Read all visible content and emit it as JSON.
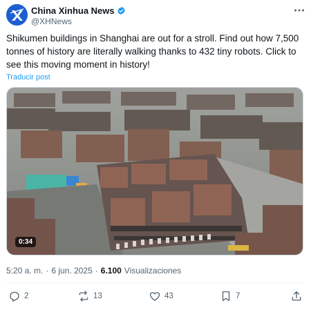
{
  "account": {
    "display_name": "China Xinhua News",
    "handle": "@XHNews",
    "avatar_logo_text": "NEW CHINA",
    "verified_icon": "verified-badge-icon"
  },
  "post": {
    "text": "Shikumen buildings in Shanghai are out for a stroll. Find out how 7,500 tonnes of history are literally walking thanks to 432 tiny robots. Click to see this moving moment in history!",
    "translate_label": "Traducir post"
  },
  "media": {
    "type": "video",
    "duration": "0:34",
    "description_icon": "video-thumbnail"
  },
  "meta": {
    "time": "5:20 a. m.",
    "separator": "·",
    "date": "6 jun. 2025",
    "views_count": "6.100",
    "views_label": "Visualizaciones"
  },
  "actions": {
    "replies": "2",
    "reposts": "13",
    "likes": "43",
    "bookmarks": "7"
  },
  "colors": {
    "accent": "#1d9bf0",
    "secondary_text": "#536471",
    "avatar_bg": "#1d5fd1"
  }
}
